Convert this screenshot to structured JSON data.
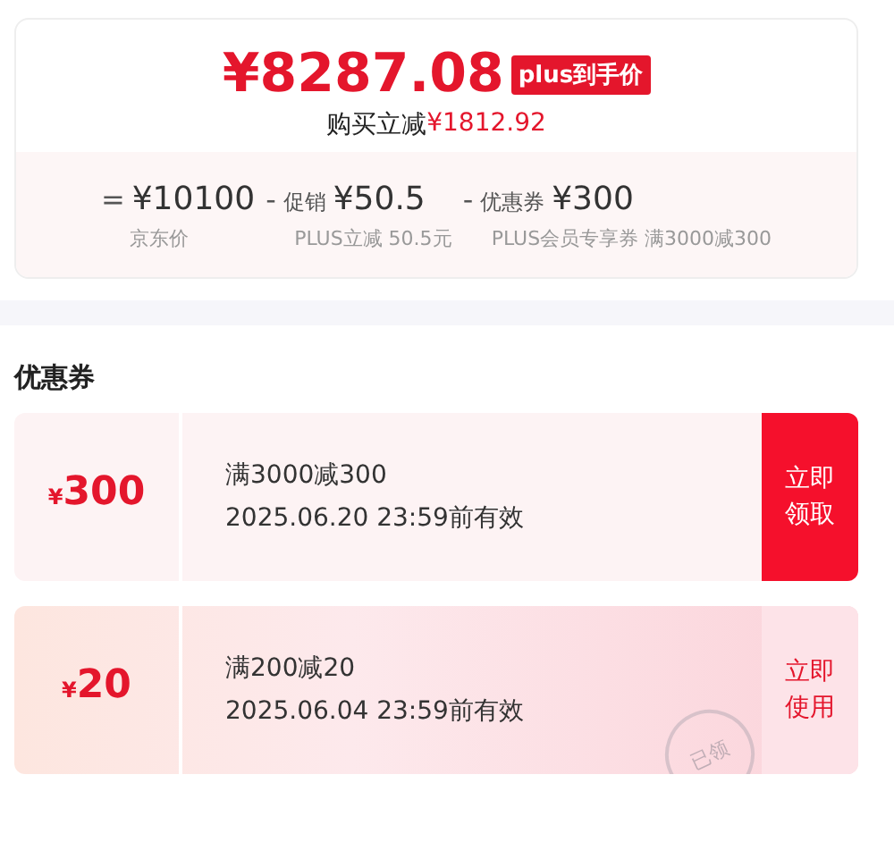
{
  "price_card": {
    "price": "¥8287.08",
    "badge": "plus到手价",
    "saving_label": "购买立减",
    "saving_amount": "¥1812.92",
    "breakdown": [
      {
        "operator": "=",
        "amount": "¥10100",
        "caption": "京东价"
      },
      {
        "operator": "-",
        "label": "促销",
        "amount": "¥50.5",
        "caption": "PLUS立减 50.5元"
      },
      {
        "operator": "-",
        "label": "优惠券",
        "amount": "¥300",
        "caption": "PLUS会员专享券 满3000减300"
      }
    ]
  },
  "coupons_section": {
    "title": "优惠券",
    "coupons": [
      {
        "kind": "claim",
        "currency": "¥",
        "amount": "300",
        "condition": "满3000减300",
        "validity": "2025.06.20 23:59前有效",
        "action": "立即领取"
      },
      {
        "kind": "claimed",
        "currency": "¥",
        "amount": "20",
        "condition": "满200减20",
        "validity": "2025.06.04 23:59前有效",
        "action": "立即使用",
        "stamp": "已领"
      }
    ]
  }
}
